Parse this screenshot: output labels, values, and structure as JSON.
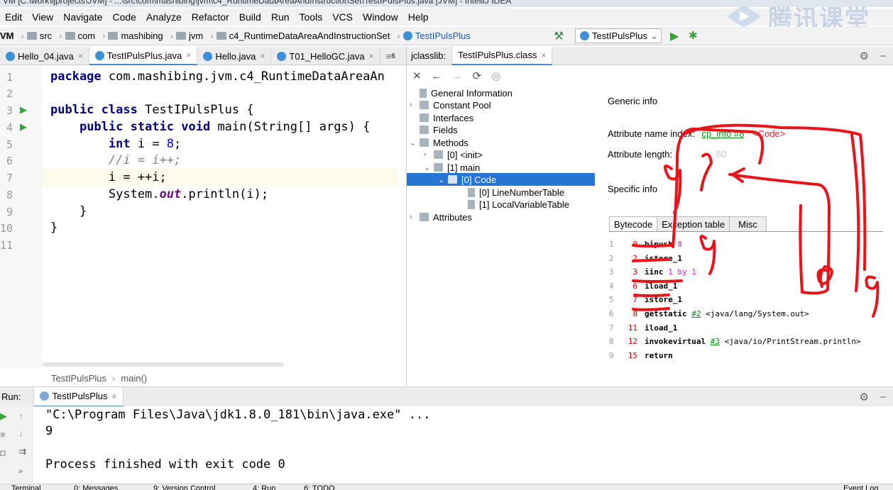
{
  "window": {
    "title": "VM [C:\\work\\ijprojects\\JVM] - ...\\src\\com\\mashibing\\jvm\\c4_RuntimeDataAreaAndInstructionSet\\TestIPulsPlus.java [JVM] - IntelliJ IDEA"
  },
  "menu": [
    "Edit",
    "View",
    "Navigate",
    "Code",
    "Analyze",
    "Refactor",
    "Build",
    "Run",
    "Tools",
    "VCS",
    "Window",
    "Help"
  ],
  "breadcrumb": {
    "project": "VM",
    "items": [
      "src",
      "com",
      "mashibing",
      "jvm",
      "c4_RuntimeDataAreaAndInstructionSet",
      "TestIPulsPlus"
    ]
  },
  "run_config": "TestIPulsPlus",
  "watermark": "腾讯课堂",
  "editor_tabs": [
    {
      "label": "Hello_04.java",
      "active": false
    },
    {
      "label": "TestIPulsPlus.java",
      "active": true
    },
    {
      "label": "Hello.java",
      "active": false
    },
    {
      "label": "T01_HelloGC.java",
      "active": false
    }
  ],
  "editor_tabs_more": "6",
  "editor": {
    "line_numbers": [
      "1",
      "2",
      "3",
      "4",
      "5",
      "6",
      "7",
      "8",
      "9",
      "10",
      "11"
    ],
    "lines": [
      "package com.mashibing.jvm.c4_RuntimeDataAreaAn",
      "",
      "public class TestIPulsPlus {",
      "    public static void main(String[] args) {",
      "        int i = 8;",
      "        //i = i++;",
      "        i = ++i;",
      "        System.out.println(i);",
      "    }",
      "}",
      ""
    ],
    "footer_crumbs": [
      "TestIPulsPlus",
      "main()"
    ]
  },
  "jclasslib": {
    "label": "jclasslib:",
    "tab": "TestIPulsPlus.class",
    "tree": [
      {
        "label": "General Information"
      },
      {
        "label": "Constant Pool"
      },
      {
        "label": "Interfaces"
      },
      {
        "label": "Fields"
      },
      {
        "label": "Methods"
      },
      {
        "label": "[0] <init>"
      },
      {
        "label": "[1] main"
      },
      {
        "label": "[0] Code"
      },
      {
        "label": "[0] LineNumberTable"
      },
      {
        "label": "[1] LocalVariableTable"
      },
      {
        "label": "Attributes"
      }
    ],
    "generic_info": "Generic info",
    "attr_name_label": "Attribute name index:",
    "attr_name_link": "cp_info #8",
    "attr_name_value": "<Code>",
    "attr_length_label": "Attribute length:",
    "attr_length_value": "80",
    "specific_info": "Specific info",
    "subtabs": [
      "Bytecode",
      "Exception table",
      "Misc"
    ],
    "bytecode": [
      {
        "n": "1",
        "off": "0",
        "op": "bipush",
        "arg": "8",
        "ref": "",
        "comment": ""
      },
      {
        "n": "2",
        "off": "2",
        "op": "istore_1",
        "arg": "",
        "ref": "",
        "comment": ""
      },
      {
        "n": "3",
        "off": "3",
        "op": "iinc",
        "arg": "1 by 1",
        "ref": "",
        "comment": ""
      },
      {
        "n": "4",
        "off": "6",
        "op": "iload_1",
        "arg": "",
        "ref": "",
        "comment": ""
      },
      {
        "n": "5",
        "off": "7",
        "op": "istore_1",
        "arg": "",
        "ref": "",
        "comment": ""
      },
      {
        "n": "6",
        "off": "8",
        "op": "getstatic",
        "arg": "",
        "ref": "#2",
        "comment": "<java/lang/System.out>"
      },
      {
        "n": "7",
        "off": "11",
        "op": "iload_1",
        "arg": "",
        "ref": "",
        "comment": ""
      },
      {
        "n": "8",
        "off": "12",
        "op": "invokevirtual",
        "arg": "",
        "ref": "#3",
        "comment": "<java/io/PrintStream.println>"
      },
      {
        "n": "9",
        "off": "15",
        "op": "return",
        "arg": "",
        "ref": "",
        "comment": ""
      }
    ]
  },
  "run": {
    "label": "Run:",
    "tab": "TestIPulsPlus",
    "console": [
      "\"C:\\Program Files\\Java\\jdk1.8.0_181\\bin\\java.exe\" ...",
      "9",
      "",
      "Process finished with exit code 0"
    ]
  },
  "statusbar": [
    "Terminal",
    "0: Messages",
    "9: Version Control",
    "4: Run",
    "6: TODO",
    "Event Log"
  ],
  "colors": {
    "selection": "#2874d4",
    "annotation": "#e8141b",
    "link": "#0a8f0a"
  }
}
